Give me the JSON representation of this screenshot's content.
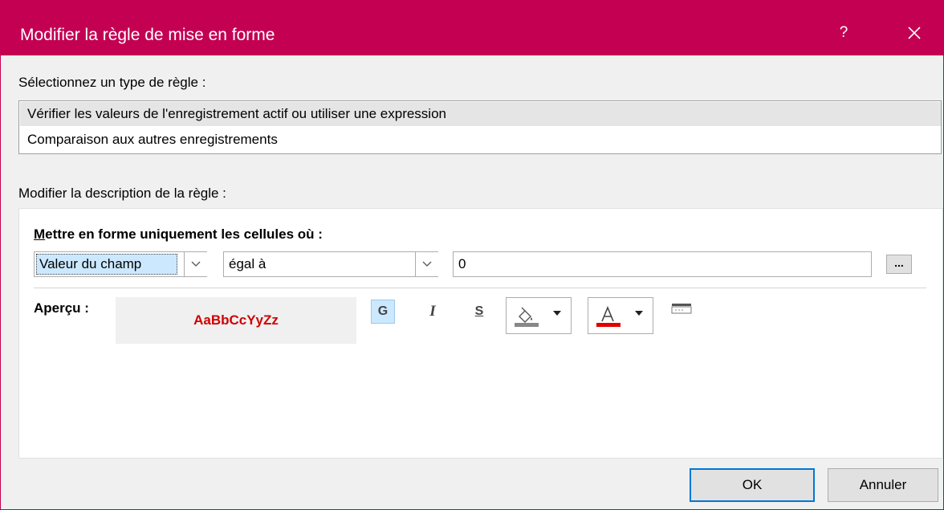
{
  "window": {
    "title": "Modifier la règle de mise en forme",
    "help": "?",
    "accent_color": "#c30052"
  },
  "rule_type": {
    "label": "Sélectionnez un type de règle :",
    "items": [
      "Vérifier les valeurs de l'enregistrement actif ou utiliser une expression",
      "Comparaison aux autres enregistrements"
    ],
    "selected_index": 0
  },
  "description": {
    "label": "Modifier la description de la règle :",
    "condition_heading_underlined": "M",
    "condition_heading_rest": "ettre en forme uniquement les cellules où :",
    "field_combo": "Valeur du champ",
    "operator_combo": "égal à",
    "value": "0",
    "ellipsis": "...",
    "preview_label": "Aperçu :",
    "preview_text": "AaBbCcYyZz",
    "preview_color": "#d00000",
    "bold": "G",
    "italic": "I",
    "underline": "S",
    "bold_active": true,
    "icons": [
      "chevron-down-icon",
      "paint-bucket-icon",
      "font-color-icon",
      "conditional-format-icon"
    ]
  },
  "buttons": {
    "ok": "OK",
    "cancel": "Annuler"
  }
}
